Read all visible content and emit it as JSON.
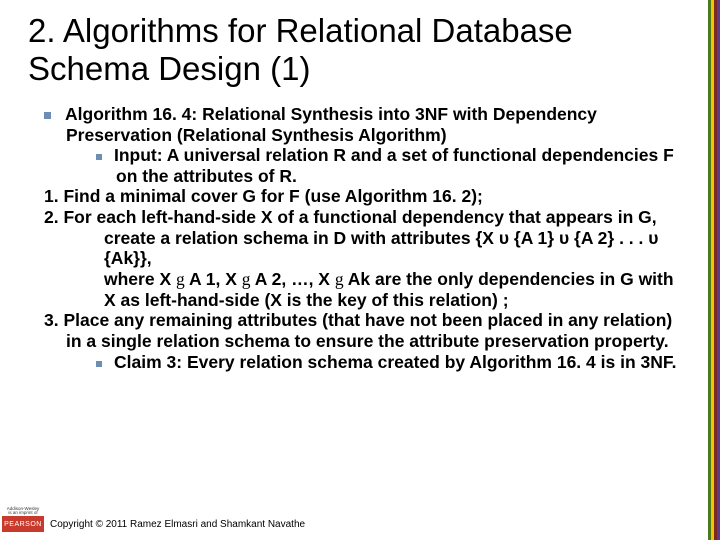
{
  "title": "2. Algorithms for Relational Database Schema Design (1)",
  "algo": {
    "heading": "Algorithm 16. 4: Relational Synthesis into 3NF with Dependency Preservation (Relational Synthesis Algorithm)",
    "input": "Input: A universal relation R and a set of functional dependencies F on the attributes of R.",
    "step1": "1. Find a minimal cover G for F (use Algorithm 16. 2);",
    "step2a": "2. For each left-hand-side X of a functional dependency that appears in G,",
    "step2b": "create a relation schema in D with attributes {X υ {A 1} υ {A 2} . . . υ {Ak}},",
    "step2c_pre": "where X ",
    "step2c_mid1": " A 1, X ",
    "step2c_mid2": " A 2, …, X ",
    "step2c_post": " Ak are the only dependencies in G with X as left-hand-side (X is the key of this relation) ;",
    "arrow": "g",
    "step3": "3. Place any remaining attributes (that have not been placed in any relation) in a single relation schema to ensure the attribute preservation property.",
    "claim": "Claim 3: Every relation schema created by Algorithm 16. 4 is in 3NF."
  },
  "logo": {
    "top1": "Addison-Wesley",
    "top2": "is an imprint of",
    "brand": "PEARSON"
  },
  "copyright": "Copyright © 2011 Ramez Elmasri and Shamkant Navathe"
}
